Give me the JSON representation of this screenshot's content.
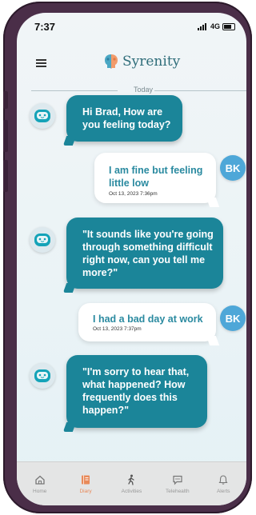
{
  "status_bar": {
    "time": "7:37",
    "network": "4G"
  },
  "header": {
    "app_name": "Syrenity"
  },
  "date_divider": "Today",
  "messages": [
    {
      "sender": "bot",
      "text": "Hi Brad, How are you feeling today?"
    },
    {
      "sender": "user",
      "initials": "BK",
      "text": "I am fine but feeling little low",
      "timestamp": "Oct 13, 2023 7:36pm"
    },
    {
      "sender": "bot",
      "text": "\"It sounds like you're going through something difficult right now, can you tell me more?\""
    },
    {
      "sender": "user",
      "initials": "BK",
      "text": "I had a bad day at work",
      "timestamp": "Oct 13, 2023 7:37pm"
    },
    {
      "sender": "bot",
      "text": "\"I'm sorry to hear that, what happened? How frequently does this happen?\""
    }
  ],
  "tabs": [
    {
      "label": "Home",
      "icon": "home-icon"
    },
    {
      "label": "Diary",
      "icon": "diary-icon",
      "active": true
    },
    {
      "label": "Activities",
      "icon": "walking-icon"
    },
    {
      "label": "Telehealth",
      "icon": "chat-icon"
    },
    {
      "label": "Alerts",
      "icon": "bell-icon"
    }
  ],
  "colors": {
    "bot_bubble": "#1b8599",
    "user_text": "#2a8aa0",
    "user_avatar": "#4ea7d8",
    "active_tab": "#e88a5a"
  }
}
